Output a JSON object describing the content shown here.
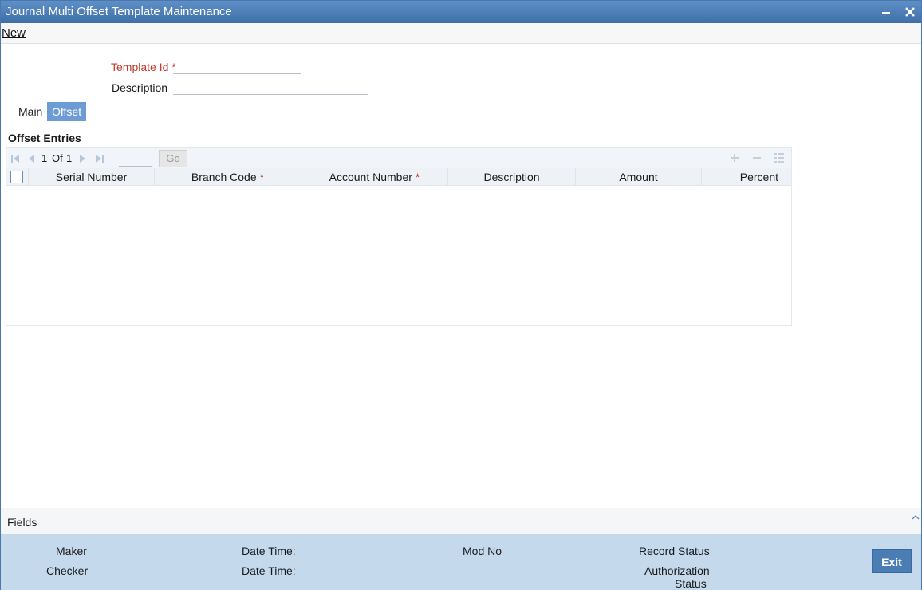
{
  "window": {
    "title": "Journal Multi Offset Template Maintenance"
  },
  "menu": {
    "new_label": "New"
  },
  "form": {
    "template_id_label": "Template Id",
    "required_marker": "*",
    "template_id_value": "",
    "description_label": "Description",
    "description_value": ""
  },
  "tabs": [
    {
      "label": "Main",
      "active": false
    },
    {
      "label": "Offset",
      "active": true
    }
  ],
  "offset_section": {
    "title": "Offset Entries",
    "pagination": {
      "current": "1",
      "of_label": "Of",
      "total": "1",
      "go_label": "Go",
      "page_input": ""
    },
    "columns": [
      {
        "label": "Serial Number",
        "required": false
      },
      {
        "label": "Branch Code",
        "required": true
      },
      {
        "label": "Account Number",
        "required": true
      },
      {
        "label": "Description",
        "required": false
      },
      {
        "label": "Amount",
        "required": false
      },
      {
        "label": "Percent",
        "required": false
      }
    ],
    "rows": []
  },
  "footer": {
    "fields_label": "Fields",
    "maker_label": "Maker",
    "checker_label": "Checker",
    "date_time_label_1": "Date Time:",
    "date_time_label_2": "Date Time:",
    "mod_no_label": "Mod No",
    "record_status_label": "Record Status",
    "authorization_label_1": "Authorization",
    "authorization_label_2": "Status",
    "exit_label": "Exit"
  },
  "colors": {
    "titlebar": "#4a7db3",
    "active_tab": "#6d9bd4",
    "required": "#c0392b",
    "audit_bg": "#c4d9ec"
  }
}
